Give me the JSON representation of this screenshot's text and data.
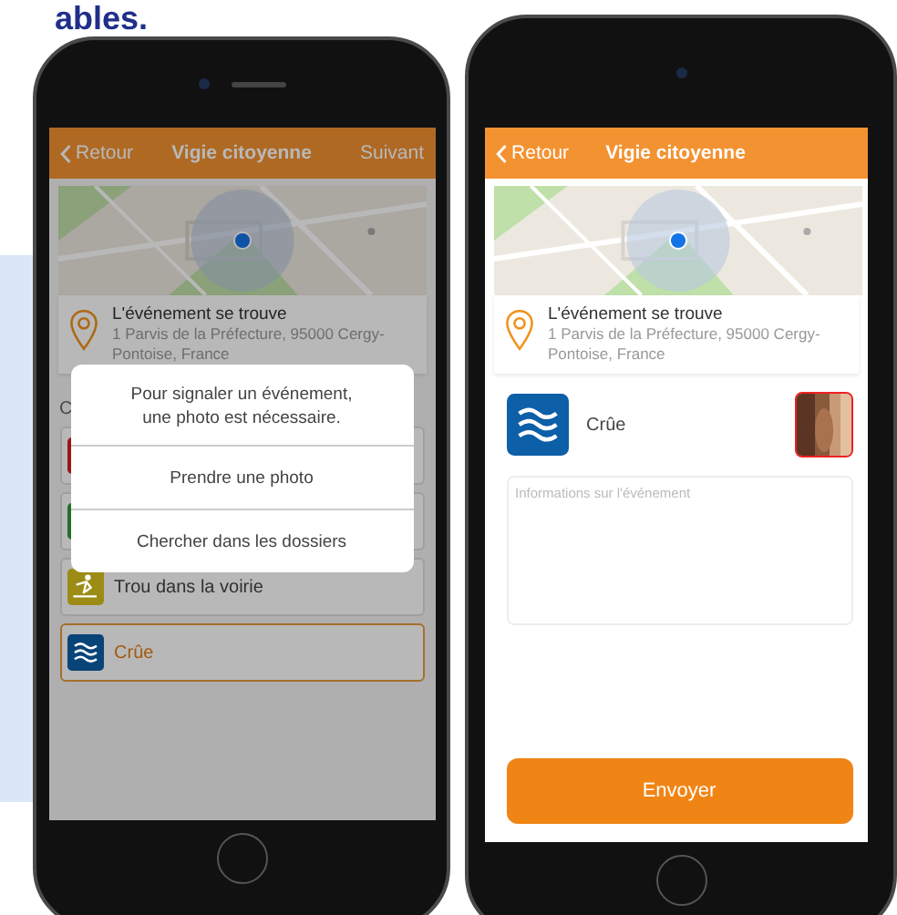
{
  "slide_heading": "ables.",
  "left_screen": {
    "nav": {
      "back": "Retour",
      "title": "Vigie citoyenne",
      "next": "Suivant"
    },
    "location": {
      "label": "L'événement se trouve",
      "address": "1 Parvis de la Préfecture, 95000 Cergy-Pontoise, France"
    },
    "list_heading": "C",
    "categories": [
      {
        "color": "#961814",
        "selected": false,
        "kind": "plain"
      },
      {
        "color": "#216f2a",
        "selected": false,
        "kind": "plain"
      },
      {
        "label": "Trou dans la voirie",
        "color": "#9c8c16",
        "selected": false,
        "kind": "hole"
      },
      {
        "label": "Crûe",
        "color": "#094479",
        "selected": true,
        "kind": "waves"
      }
    ],
    "dialog": {
      "message": "Pour signaler un événement,\nune photo est nécessaire.",
      "actions": [
        "Prendre une photo",
        "Chercher dans les dossiers"
      ]
    }
  },
  "right_screen": {
    "nav": {
      "back": "Retour",
      "title": "Vigie citoyenne"
    },
    "location": {
      "label": "L'événement se trouve",
      "address": "1 Parvis de la Préfecture, 95000 Cergy-Pontoise, France"
    },
    "category": {
      "label": "Crûe",
      "color": "#0d5fa8",
      "kind": "waves"
    },
    "details": {
      "placeholder": "Informations sur l'événement"
    },
    "submit": "Envoyer"
  }
}
